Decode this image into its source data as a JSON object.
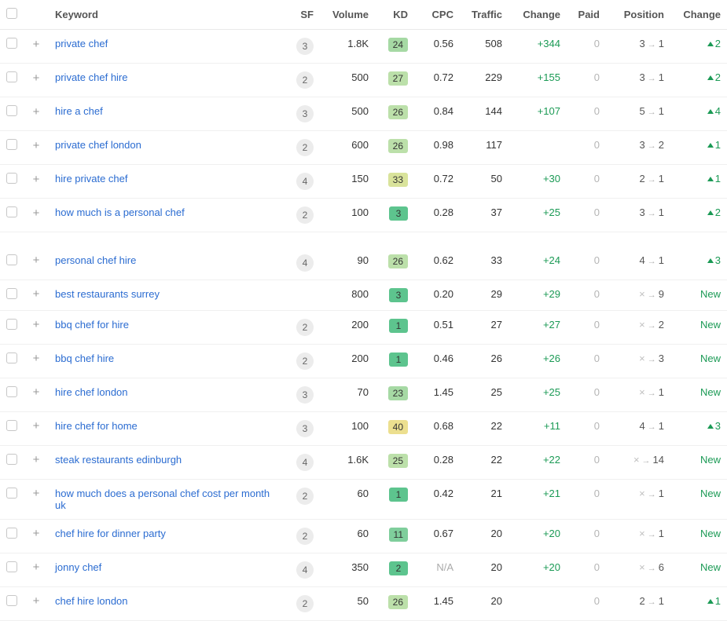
{
  "headers": {
    "keyword": "Keyword",
    "sf": "SF",
    "volume": "Volume",
    "kd": "KD",
    "cpc": "CPC",
    "traffic": "Traffic",
    "change": "Change",
    "paid": "Paid",
    "position": "Position",
    "pos_change": "Change"
  },
  "kd_colors": {
    "vlow": "#5dc48e",
    "low": "#7fce9c",
    "mlow": "#a6d9a4",
    "med": "#bce0aa",
    "mhigh": "#d9e39b",
    "high": "#ecdf8f"
  },
  "rows": [
    {
      "keyword": "private chef",
      "sf": "3",
      "volume": "1.8K",
      "kd": "24",
      "kd_tier": "mlow",
      "cpc": "0.56",
      "traffic": "508",
      "t_change": "+344",
      "paid": "0",
      "pos_from": "3",
      "pos_to": "1",
      "p_change_type": "up",
      "p_change_val": "2"
    },
    {
      "keyword": "private chef hire",
      "sf": "2",
      "volume": "500",
      "kd": "27",
      "kd_tier": "med",
      "cpc": "0.72",
      "traffic": "229",
      "t_change": "+155",
      "paid": "0",
      "pos_from": "3",
      "pos_to": "1",
      "p_change_type": "up",
      "p_change_val": "2"
    },
    {
      "keyword": "hire a chef",
      "sf": "3",
      "volume": "500",
      "kd": "26",
      "kd_tier": "med",
      "cpc": "0.84",
      "traffic": "144",
      "t_change": "+107",
      "paid": "0",
      "pos_from": "5",
      "pos_to": "1",
      "p_change_type": "up",
      "p_change_val": "4"
    },
    {
      "keyword": "private chef london",
      "sf": "2",
      "volume": "600",
      "kd": "26",
      "kd_tier": "med",
      "cpc": "0.98",
      "traffic": "117",
      "t_change": "",
      "paid": "0",
      "pos_from": "3",
      "pos_to": "2",
      "p_change_type": "up",
      "p_change_val": "1"
    },
    {
      "keyword": "hire private chef",
      "sf": "4",
      "volume": "150",
      "kd": "33",
      "kd_tier": "mhigh",
      "cpc": "0.72",
      "traffic": "50",
      "t_change": "+30",
      "paid": "0",
      "pos_from": "2",
      "pos_to": "1",
      "p_change_type": "up",
      "p_change_val": "1"
    },
    {
      "keyword": "how much is a personal chef",
      "sf": "2",
      "volume": "100",
      "kd": "3",
      "kd_tier": "vlow",
      "cpc": "0.28",
      "traffic": "37",
      "t_change": "+25",
      "paid": "0",
      "pos_from": "3",
      "pos_to": "1",
      "p_change_type": "up",
      "p_change_val": "2"
    },
    {
      "spacer": true
    },
    {
      "keyword": "personal chef hire",
      "sf": "4",
      "volume": "90",
      "kd": "26",
      "kd_tier": "med",
      "cpc": "0.62",
      "traffic": "33",
      "t_change": "+24",
      "paid": "0",
      "pos_from": "4",
      "pos_to": "1",
      "p_change_type": "up",
      "p_change_val": "3"
    },
    {
      "keyword": "best restaurants surrey",
      "sf": "",
      "volume": "800",
      "kd": "3",
      "kd_tier": "vlow",
      "cpc": "0.20",
      "traffic": "29",
      "t_change": "+29",
      "paid": "0",
      "pos_from": "",
      "pos_to": "9",
      "p_change_type": "new",
      "p_change_val": "New"
    },
    {
      "keyword": "bbq chef for hire",
      "sf": "2",
      "volume": "200",
      "kd": "1",
      "kd_tier": "vlow",
      "cpc": "0.51",
      "traffic": "27",
      "t_change": "+27",
      "paid": "0",
      "pos_from": "",
      "pos_to": "2",
      "p_change_type": "new",
      "p_change_val": "New"
    },
    {
      "keyword": "bbq chef hire",
      "sf": "2",
      "volume": "200",
      "kd": "1",
      "kd_tier": "vlow",
      "cpc": "0.46",
      "traffic": "26",
      "t_change": "+26",
      "paid": "0",
      "pos_from": "",
      "pos_to": "3",
      "p_change_type": "new",
      "p_change_val": "New"
    },
    {
      "keyword": "hire chef london",
      "sf": "3",
      "volume": "70",
      "kd": "23",
      "kd_tier": "mlow",
      "cpc": "1.45",
      "traffic": "25",
      "t_change": "+25",
      "paid": "0",
      "pos_from": "",
      "pos_to": "1",
      "p_change_type": "new",
      "p_change_val": "New"
    },
    {
      "keyword": "hire chef for home",
      "sf": "3",
      "volume": "100",
      "kd": "40",
      "kd_tier": "high",
      "cpc": "0.68",
      "traffic": "22",
      "t_change": "+11",
      "paid": "0",
      "pos_from": "4",
      "pos_to": "1",
      "p_change_type": "up",
      "p_change_val": "3"
    },
    {
      "keyword": "steak restaurants edinburgh",
      "sf": "4",
      "volume": "1.6K",
      "kd": "25",
      "kd_tier": "med",
      "cpc": "0.28",
      "traffic": "22",
      "t_change": "+22",
      "paid": "0",
      "pos_from": "",
      "pos_to": "14",
      "p_change_type": "new",
      "p_change_val": "New"
    },
    {
      "keyword": "how much does a personal chef cost per month uk",
      "sf": "2",
      "volume": "60",
      "kd": "1",
      "kd_tier": "vlow",
      "cpc": "0.42",
      "traffic": "21",
      "t_change": "+21",
      "paid": "0",
      "pos_from": "",
      "pos_to": "1",
      "p_change_type": "new",
      "p_change_val": "New"
    },
    {
      "keyword": "chef hire for dinner party",
      "sf": "2",
      "volume": "60",
      "kd": "11",
      "kd_tier": "low",
      "cpc": "0.67",
      "traffic": "20",
      "t_change": "+20",
      "paid": "0",
      "pos_from": "",
      "pos_to": "1",
      "p_change_type": "new",
      "p_change_val": "New"
    },
    {
      "keyword": "jonny chef",
      "sf": "4",
      "volume": "350",
      "kd": "2",
      "kd_tier": "vlow",
      "cpc": "N/A",
      "cpc_gray": true,
      "traffic": "20",
      "t_change": "+20",
      "paid": "0",
      "pos_from": "",
      "pos_to": "6",
      "p_change_type": "new",
      "p_change_val": "New"
    },
    {
      "keyword": "chef hire london",
      "sf": "2",
      "volume": "50",
      "kd": "26",
      "kd_tier": "med",
      "cpc": "1.45",
      "traffic": "20",
      "t_change": "",
      "paid": "0",
      "pos_from": "2",
      "pos_to": "1",
      "p_change_type": "up",
      "p_change_val": "1"
    }
  ]
}
